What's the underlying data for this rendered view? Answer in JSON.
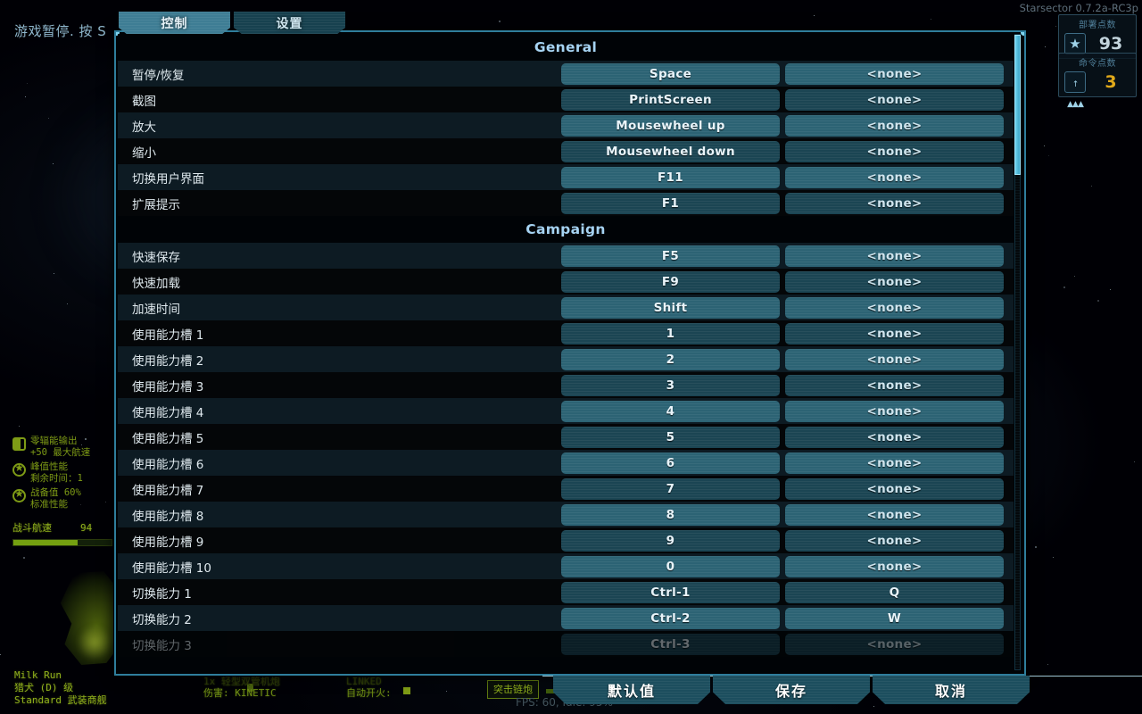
{
  "window": {
    "version_text": "Starsector 0.7.2a-RC3p",
    "pause_notice": "游戏暂停. 按 S",
    "fps_text": "FPS: 60, Idle: 95%"
  },
  "hud": {
    "deploy_points": {
      "caption": "部署点数",
      "value": "93",
      "icon": "star-badge-icon"
    },
    "command_points": {
      "caption": "命令点数",
      "value": "3",
      "icon": "command-arrow-icon",
      "color": "#e0a91a"
    },
    "ship": {
      "name": "Milk Run",
      "hull_class": "猎犬 (D) 级",
      "variant": "Standard 武装商舰"
    },
    "stats": [
      {
        "icon": "flux-vent-icon",
        "line1": "零辐能输出",
        "line2": "+50 最大航速"
      },
      {
        "icon": "star-icon",
        "line1": "峰值性能",
        "line2": "剩余时间：1"
      },
      {
        "icon": "star-icon",
        "line1": "战备值 60%",
        "line2": "标准性能"
      }
    ],
    "combat_speed": {
      "label": "战斗航速",
      "value": "94"
    },
    "weapon": {
      "group_name": "突击链炮",
      "mount": "1x 轻型双管机炮",
      "damage": "伤害: KINETIC",
      "link_mode": "LINKED",
      "autofire": "自动开火:"
    }
  },
  "tabs": [
    {
      "label": "控制",
      "active": true
    },
    {
      "label": "设置",
      "active": false
    }
  ],
  "footer": {
    "buttons": [
      {
        "label": "默认值",
        "name": "defaults-button"
      },
      {
        "label": "保存",
        "name": "save-button"
      },
      {
        "label": "取消",
        "name": "cancel-button"
      }
    ]
  },
  "keybinds": {
    "sections": [
      {
        "title": "General",
        "rows": [
          {
            "label": "暂停/恢复",
            "primary": "Space",
            "secondary": "<none>"
          },
          {
            "label": "截图",
            "primary": "PrintScreen",
            "secondary": "<none>"
          },
          {
            "label": "放大",
            "primary": "Mousewheel up",
            "secondary": "<none>"
          },
          {
            "label": "缩小",
            "primary": "Mousewheel down",
            "secondary": "<none>"
          },
          {
            "label": "切换用户界面",
            "primary": "F11",
            "secondary": "<none>"
          },
          {
            "label": "扩展提示",
            "primary": "F1",
            "secondary": "<none>"
          }
        ]
      },
      {
        "title": "Campaign",
        "rows": [
          {
            "label": "快速保存",
            "primary": "F5",
            "secondary": "<none>"
          },
          {
            "label": "快速加载",
            "primary": "F9",
            "secondary": "<none>"
          },
          {
            "label": "加速时间",
            "primary": "Shift",
            "secondary": "<none>"
          },
          {
            "label": "使用能力槽 1",
            "primary": "1",
            "secondary": "<none>"
          },
          {
            "label": "使用能力槽 2",
            "primary": "2",
            "secondary": "<none>"
          },
          {
            "label": "使用能力槽 3",
            "primary": "3",
            "secondary": "<none>"
          },
          {
            "label": "使用能力槽 4",
            "primary": "4",
            "secondary": "<none>"
          },
          {
            "label": "使用能力槽 5",
            "primary": "5",
            "secondary": "<none>"
          },
          {
            "label": "使用能力槽 6",
            "primary": "6",
            "secondary": "<none>"
          },
          {
            "label": "使用能力槽 7",
            "primary": "7",
            "secondary": "<none>"
          },
          {
            "label": "使用能力槽 8",
            "primary": "8",
            "secondary": "<none>"
          },
          {
            "label": "使用能力槽 9",
            "primary": "9",
            "secondary": "<none>"
          },
          {
            "label": "使用能力槽 10",
            "primary": "0",
            "secondary": "<none>"
          },
          {
            "label": "切换能力 1",
            "primary": "Ctrl-1",
            "secondary": "Q"
          },
          {
            "label": "切换能力 2",
            "primary": "Ctrl-2",
            "secondary": "W"
          },
          {
            "label": "切换能力 3",
            "primary": "Ctrl-3",
            "secondary": "<none>",
            "clipped": true
          }
        ]
      }
    ]
  },
  "scrollbar": {
    "thumb_top_pct": 0,
    "thumb_height_pct": 22
  },
  "colors": {
    "accent": "#2f7e9c",
    "panel_bg": "#000306",
    "row_alt": "#0d1b23",
    "row_norm": "#040608",
    "btn_light": "#2c6374",
    "btn_dark": "#1b4553",
    "section_title": "#a6d3f2",
    "hud_green": "#7e9b16",
    "gold": "#e0a91a"
  }
}
